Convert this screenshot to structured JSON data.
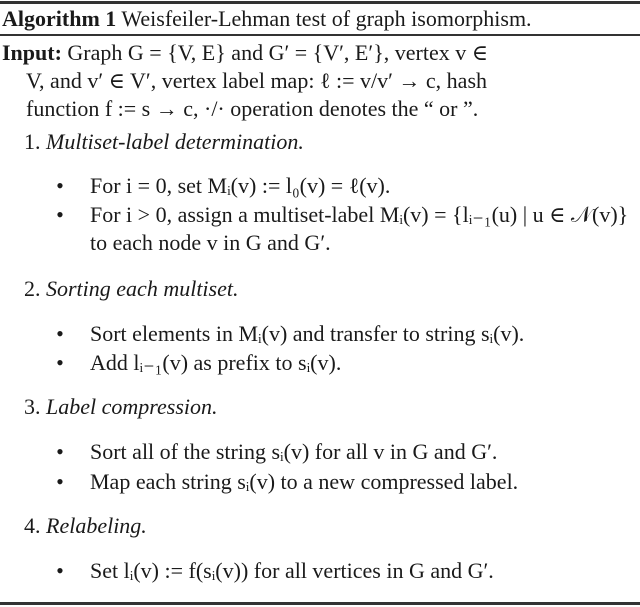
{
  "algorithm": {
    "label": "Algorithm 1",
    "caption": "Weisfeiler-Lehman test of graph isomorphism.",
    "input_label": "Input:",
    "input_lines": [
      "Graph G = {V, E} and G′ = {V′, E′}, vertex v ∈",
      "V, and v′ ∈ V′, vertex label map: ℓ := v/v′ → c, hash",
      "function f := s → c, ·/· operation denotes the “ or ”."
    ],
    "steps": [
      {
        "number": "1.",
        "title": "Multiset-label determination.",
        "items": [
          "For i = 0, set Mᵢ(v) := l₀(v) = ℓ(v).",
          "For i > 0, assign a multiset-label Mᵢ(v) = {lᵢ₋₁(u) | u ∈ 𝒩(v)} to each node v in G and G′."
        ]
      },
      {
        "number": "2.",
        "title": "Sorting each multiset.",
        "items": [
          "Sort elements in Mᵢ(v) and transfer to string sᵢ(v).",
          "Add lᵢ₋₁(v) as prefix to sᵢ(v)."
        ]
      },
      {
        "number": "3.",
        "title": "Label compression.",
        "items": [
          "Sort all of the string sᵢ(v) for all v in G and G′.",
          "Map each string sᵢ(v) to a new compressed label."
        ]
      },
      {
        "number": "4.",
        "title": "Relabeling.",
        "items": [
          "Set lᵢ(v) := f(sᵢ(v)) for all vertices in G and G′."
        ]
      }
    ],
    "bullet_glyph": "•"
  }
}
